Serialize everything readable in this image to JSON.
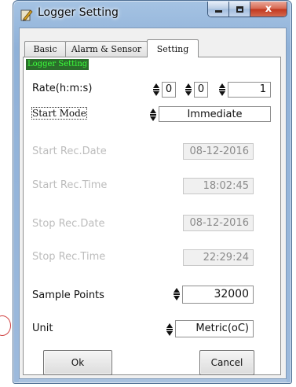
{
  "window": {
    "title": "Logger Setting",
    "close_glyph": "x"
  },
  "tabs": [
    {
      "label": "Basic",
      "active": false
    },
    {
      "label": "Alarm & Sensor",
      "active": false
    },
    {
      "label": "Setting",
      "active": true
    }
  ],
  "group": {
    "label": "Logger Setting"
  },
  "rate": {
    "label": "Rate(h:m:s)",
    "hours": "0",
    "minutes": "0",
    "seconds": "1"
  },
  "start_mode": {
    "label": "Start Mode",
    "value": "Immediate"
  },
  "start_rec_date": {
    "label": "Start Rec.Date",
    "value": "08-12-2016"
  },
  "start_rec_time": {
    "label": "Start Rec.Time",
    "value": "18:02:45"
  },
  "stop_rec_date": {
    "label": "Stop Rec.Date",
    "value": "08-12-2016"
  },
  "stop_rec_time": {
    "label": "Stop Rec.Time",
    "value": "22:29:24"
  },
  "sample_points": {
    "label": "Sample Points",
    "value": "32000"
  },
  "unit": {
    "label": "Unit",
    "value": "Metric(oC)"
  },
  "buttons": {
    "ok": "Ok",
    "cancel": "Cancel"
  },
  "icons": {
    "app": "logger-app-icon",
    "spinner": "spinner-arrows-icon"
  },
  "colors": {
    "group_label_bg": "#2b6e2b",
    "group_label_fg": "#3cff3c",
    "close_button": "#c8432a"
  }
}
